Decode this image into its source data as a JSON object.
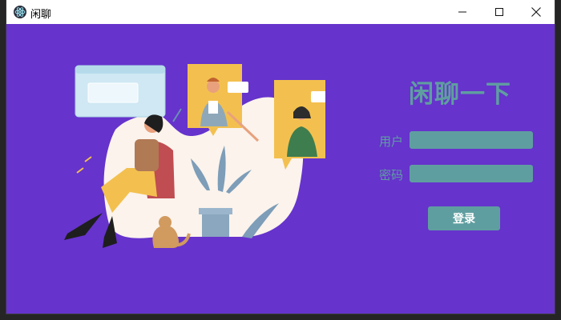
{
  "window": {
    "title": "闲聊",
    "controls": {
      "minimize_icon": "minimize-icon",
      "maximize_icon": "maximize-icon",
      "close_icon": "close-icon"
    }
  },
  "login": {
    "heading": "闲聊一下",
    "username_label": "用户",
    "password_label": "密码",
    "username_value": "",
    "password_value": "",
    "submit_label": "登录"
  },
  "colors": {
    "background": "#6633cc",
    "accent": "#5f9ea0",
    "titlebar": "#ffffff",
    "illustration_bg": "#fbf3ec",
    "card_yellow": "#f3c04f"
  }
}
